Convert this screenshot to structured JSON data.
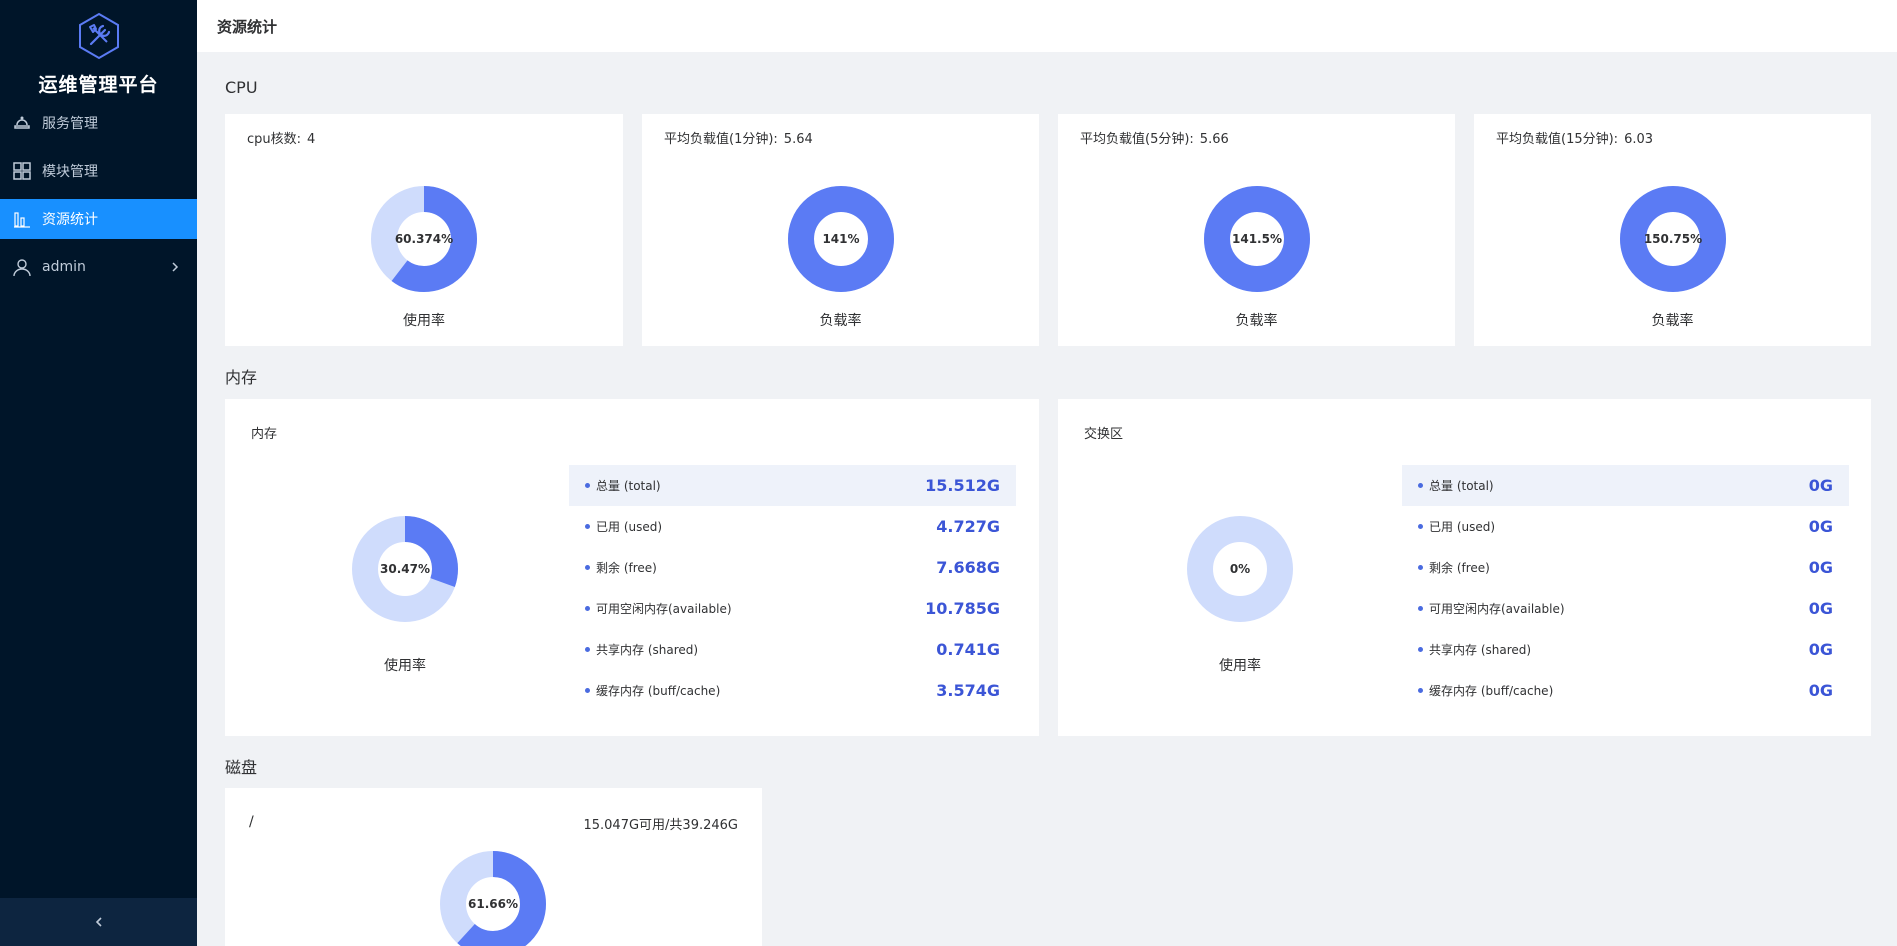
{
  "app": {
    "title": "运维管理平台"
  },
  "sidebar": {
    "items": [
      {
        "label": "服务管理",
        "icon": "service-icon"
      },
      {
        "label": "模块管理",
        "icon": "grid-icon"
      },
      {
        "label": "资源统计",
        "icon": "bar-chart-icon",
        "active": true
      },
      {
        "label": "admin",
        "icon": "user-icon"
      }
    ]
  },
  "header": {
    "title": "资源统计"
  },
  "colors": {
    "accent": "#1890ff",
    "donut_fg": "#5b7bf4",
    "donut_bg": "#cfdcfc",
    "value_text": "#3b55d6",
    "sidebar_bg": "#001529"
  },
  "cpu": {
    "section_title": "CPU",
    "cards": [
      {
        "label": "cpu核数:",
        "value": "4",
        "percent_text": "60.374%",
        "percent": 60.374,
        "caption": "使用率"
      },
      {
        "label": "平均负载值(1分钟):",
        "value": "5.64",
        "percent_text": "141%",
        "percent": 141,
        "caption": "负载率"
      },
      {
        "label": "平均负载值(5分钟):",
        "value": "5.66",
        "percent_text": "141.5%",
        "percent": 141.5,
        "caption": "负载率"
      },
      {
        "label": "平均负载值(15分钟):",
        "value": "6.03",
        "percent_text": "150.75%",
        "percent": 150.75,
        "caption": "负载率"
      }
    ]
  },
  "memory": {
    "section_title": "内存",
    "mem": {
      "label": "内存",
      "percent_text": "30.47%",
      "percent": 30.47,
      "caption": "使用率",
      "rows": [
        {
          "k": "总量 (total)",
          "v": "15.512G"
        },
        {
          "k": "已用 (used)",
          "v": "4.727G"
        },
        {
          "k": "剩余 (free)",
          "v": "7.668G"
        },
        {
          "k": "可用空闲内存(available)",
          "v": "10.785G"
        },
        {
          "k": "共享内存 (shared)",
          "v": "0.741G"
        },
        {
          "k": "缓存内存 (buff/cache)",
          "v": "3.574G"
        }
      ]
    },
    "swap": {
      "label": "交换区",
      "percent_text": "0%",
      "percent": 0,
      "caption": "使用率",
      "rows": [
        {
          "k": "总量 (total)",
          "v": "0G"
        },
        {
          "k": "已用 (used)",
          "v": "0G"
        },
        {
          "k": "剩余 (free)",
          "v": "0G"
        },
        {
          "k": "可用空闲内存(available)",
          "v": "0G"
        },
        {
          "k": "共享内存 (shared)",
          "v": "0G"
        },
        {
          "k": "缓存内存 (buff/cache)",
          "v": "0G"
        }
      ]
    }
  },
  "disk": {
    "section_title": "磁盘",
    "cards": [
      {
        "path": "/",
        "info": "15.047G可用/共39.246G",
        "percent_text": "61.66%",
        "percent": 61.66
      }
    ]
  }
}
